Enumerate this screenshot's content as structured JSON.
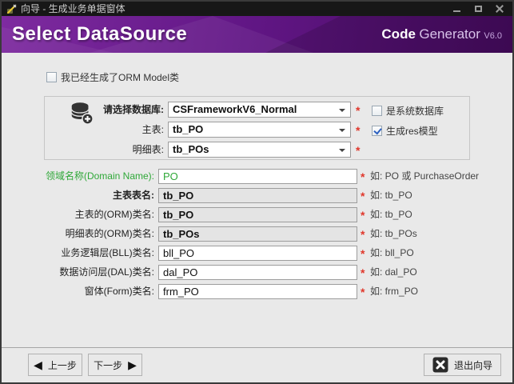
{
  "colors": {
    "accent_purple": "#5e1580",
    "green": "#2fa838",
    "required_red": "#e0372b",
    "check_blue": "#2b5fc0",
    "titlebar_bg": "#171717"
  },
  "required_mark": "*",
  "window": {
    "title": "向导 - 生成业务单据窗体"
  },
  "header": {
    "title": "Select DataSource",
    "brand_code": "Code",
    "brand_generator": "Generator",
    "brand_version": "V6.0"
  },
  "orm_checkbox": {
    "label": "我已经生成了ORM Model类",
    "checked": false
  },
  "datasource_group": {
    "rows": [
      {
        "label": "请选择数据库:",
        "value": "CSFrameworkV6_Normal"
      },
      {
        "label": "主表:",
        "value": "tb_PO"
      },
      {
        "label": "明细表:",
        "value": "tb_POs"
      }
    ],
    "checkboxes": [
      {
        "label": "是系统数据库",
        "checked": false
      },
      {
        "label": "生成res模型",
        "checked": true
      }
    ]
  },
  "form": {
    "rows": [
      {
        "label": "领域名称(Domain Name):",
        "value": "PO",
        "hint": "如: PO 或 PurchaseOrder"
      },
      {
        "label": "主表表名:",
        "value": "tb_PO",
        "hint": "如: tb_PO"
      },
      {
        "label": "主表的(ORM)类名:",
        "value": "tb_PO",
        "hint": "如: tb_PO"
      },
      {
        "label": "明细表的(ORM)类名:",
        "value": "tb_POs",
        "hint": "如: tb_POs"
      },
      {
        "label": "业务逻辑层(BLL)类名:",
        "value": "bll_PO",
        "hint": "如: bll_PO"
      },
      {
        "label": "数据访问层(DAL)类名:",
        "value": "dal_PO",
        "hint": "如: dal_PO"
      },
      {
        "label": "窗体(Form)类名:",
        "value": "frm_PO",
        "hint": "如: frm_PO"
      }
    ]
  },
  "footer": {
    "prev_label": "上一步",
    "next_label": "下一步",
    "exit_label": "退出向导",
    "prev_arrow": "◀",
    "next_arrow": "▶"
  }
}
